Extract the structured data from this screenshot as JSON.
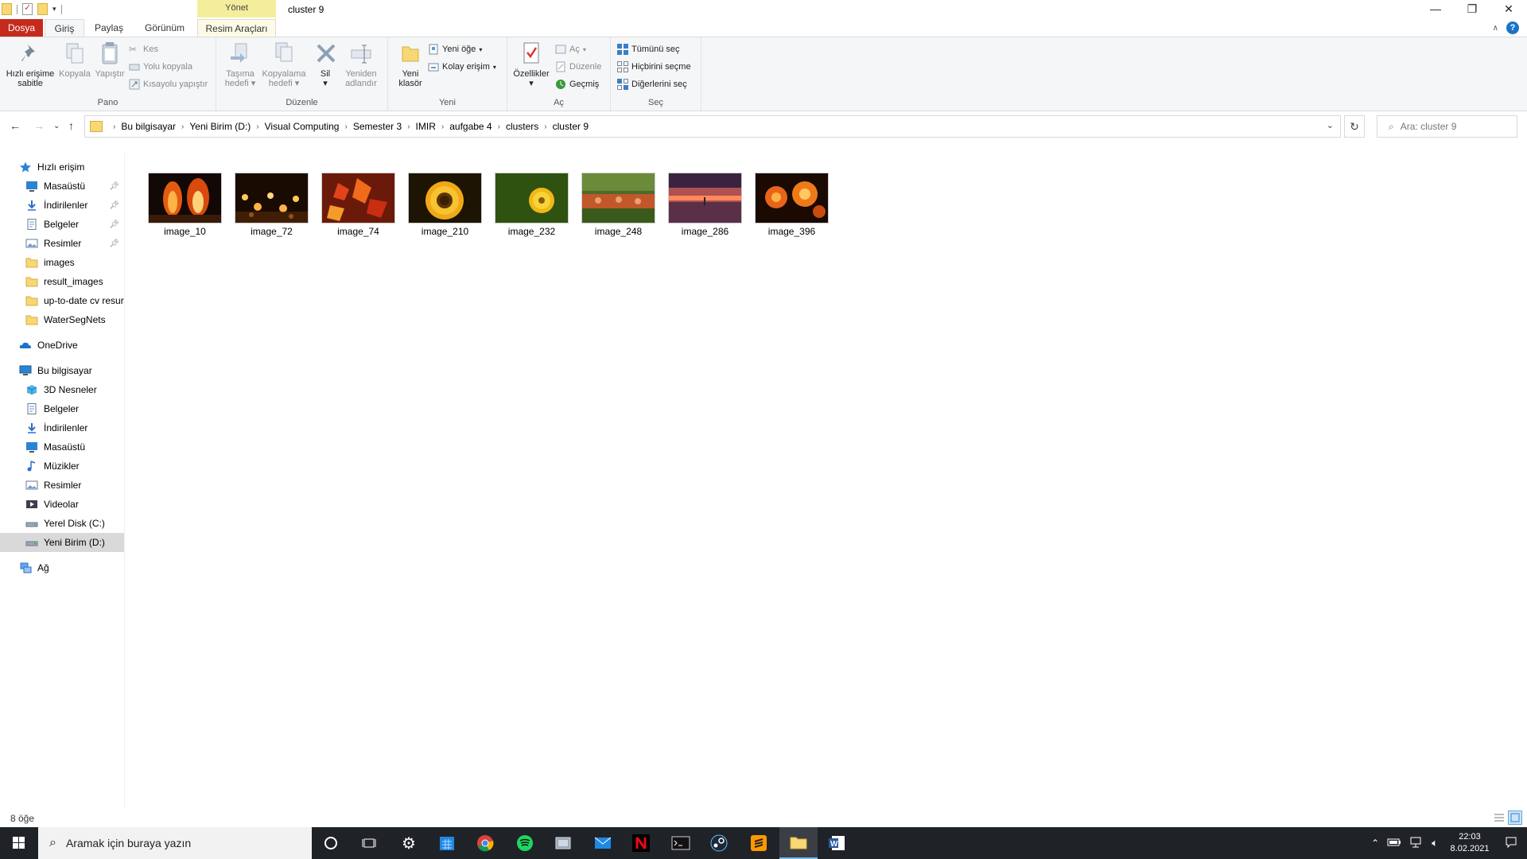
{
  "window": {
    "title": "cluster 9",
    "context_tab_top": "Yönet",
    "controls": {
      "minimize": "—",
      "maximize": "❐",
      "close": "✕"
    }
  },
  "tabs": {
    "file": "Dosya",
    "home": "Giriş",
    "share": "Paylaş",
    "view": "Görünüm",
    "picture_tools": "Resim Araçları"
  },
  "ribbon": {
    "pano": {
      "label": "Pano",
      "pin_quick_line1": "Hızlı erişime",
      "pin_quick_line2": "sabitle",
      "copy": "Kopyala",
      "paste": "Yapıştır",
      "cut": "Kes",
      "copy_path": "Yolu kopyala",
      "paste_shortcut": "Kısayolu yapıştır"
    },
    "organize": {
      "label": "Düzenle",
      "move_line1": "Taşıma",
      "move_line2": "hedefi",
      "copy_to_line1": "Kopyalama",
      "copy_to_line2": "hedefi",
      "delete": "Sil",
      "rename_line1": "Yeniden",
      "rename_line2": "adlandır"
    },
    "new": {
      "label": "Yeni",
      "new_folder_line1": "Yeni",
      "new_folder_line2": "klasör",
      "new_item": "Yeni öğe",
      "easy_access": "Kolay erişim"
    },
    "open": {
      "label": "Aç",
      "properties": "Özellikler",
      "open": "Aç",
      "edit": "Düzenle",
      "history": "Geçmiş"
    },
    "select": {
      "label": "Seç",
      "select_all": "Tümünü seç",
      "select_none": "Hiçbirini seçme",
      "invert": "Diğerlerini seç"
    }
  },
  "address": {
    "crumbs": [
      "Bu bilgisayar",
      "Yeni Birim (D:)",
      "Visual Computing",
      "Semester 3",
      "IMIR",
      "aufgabe 4",
      "clusters",
      "cluster 9"
    ]
  },
  "search": {
    "placeholder": "Ara: cluster 9"
  },
  "sidebar": {
    "quick_access": "Hızlı erişim",
    "quick_items": [
      {
        "label": "Masaüstü",
        "icon": "desktop-icon",
        "pinned": true
      },
      {
        "label": "İndirilenler",
        "icon": "download-icon",
        "pinned": true
      },
      {
        "label": "Belgeler",
        "icon": "documents-icon",
        "pinned": true
      },
      {
        "label": "Resimler",
        "icon": "pictures-icon",
        "pinned": true
      },
      {
        "label": "images",
        "icon": "folder-icon",
        "pinned": false
      },
      {
        "label": "result_images",
        "icon": "folder-icon",
        "pinned": false
      },
      {
        "label": "up-to-date cv resur",
        "icon": "folder-icon",
        "pinned": false
      },
      {
        "label": "WaterSegNets",
        "icon": "folder-icon",
        "pinned": false
      }
    ],
    "onedrive": "OneDrive",
    "this_pc": "Bu bilgisayar",
    "pc_items": [
      {
        "label": "3D Nesneler",
        "icon": "3d-objects-icon"
      },
      {
        "label": "Belgeler",
        "icon": "documents-icon"
      },
      {
        "label": "İndirilenler",
        "icon": "download-icon"
      },
      {
        "label": "Masaüstü",
        "icon": "desktop-icon"
      },
      {
        "label": "Müzikler",
        "icon": "music-icon"
      },
      {
        "label": "Resimler",
        "icon": "pictures-icon"
      },
      {
        "label": "Videolar",
        "icon": "videos-icon"
      },
      {
        "label": "Yerel Disk (C:)",
        "icon": "drive-icon"
      },
      {
        "label": "Yeni Birim (D:)",
        "icon": "drive-icon"
      }
    ],
    "network": "Ağ"
  },
  "files": [
    {
      "name": "image_10",
      "palette": "fire"
    },
    {
      "name": "image_72",
      "palette": "candles"
    },
    {
      "name": "image_74",
      "palette": "autumn-leaves"
    },
    {
      "name": "image_210",
      "palette": "sunflower"
    },
    {
      "name": "image_232",
      "palette": "yellow-flower-green"
    },
    {
      "name": "image_248",
      "palette": "field"
    },
    {
      "name": "image_286",
      "palette": "sunset"
    },
    {
      "name": "image_396",
      "palette": "orange-flowers"
    }
  ],
  "status": {
    "count": "8 öğe"
  },
  "taskbar": {
    "search_placeholder": "Aramak için buraya yazın",
    "time": "22:03",
    "date": "8.02.2021"
  }
}
